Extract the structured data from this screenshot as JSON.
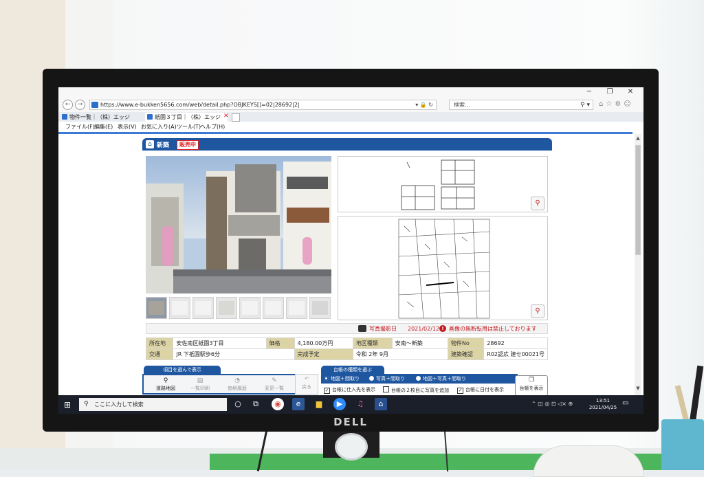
{
  "browser": {
    "url": "https://www.e-bukken5656.com/web/detail.php?OBJKEYS[]=02|28692|2|",
    "search_placeholder": "検索...",
    "tabs": [
      {
        "label": "物件一覧｜（株）エッジ"
      },
      {
        "label": "紙園３丁目｜（株）エッジ"
      }
    ],
    "menu": [
      "ファイル(F)",
      "編集(E)",
      "表示(V)",
      "お気に入り(A)",
      "ツール(T)",
      "ヘルプ(H)"
    ]
  },
  "listing": {
    "category": "新築",
    "status_badge": "販売中",
    "photo_date_label": "写真撮影日",
    "photo_date": "2021/02/12",
    "notice": "画像の無断転用は禁止しております",
    "info": {
      "row1": [
        {
          "key": "所在地",
          "value": "安佐南区紙園3丁目"
        },
        {
          "key": "価格",
          "value": "4,180.00万円"
        },
        {
          "key": "地区種類",
          "value": "安南～新築"
        },
        {
          "key": "物件No",
          "value": "28692"
        }
      ],
      "row2": [
        {
          "key": "交通",
          "value": "JR 下祇園駅歩6分"
        },
        {
          "key": "完成予定",
          "value": "令和 2年 9月"
        },
        {
          "key": "建築確認",
          "value": "R02認広 建セ00021号"
        }
      ]
    }
  },
  "tools": {
    "section1_label": "項目を選んで表示",
    "buttons": [
      "道路地図",
      "一覧印刷",
      "価格履歴",
      "変更一覧"
    ],
    "print_button": "戻る",
    "section2_label": "台帳の種類を選ぶ",
    "radios": [
      "地図＋間取り",
      "写真＋間取り",
      "地図＋写真＋間取り"
    ],
    "checks": [
      {
        "label": "台帳に仕入先を表示",
        "checked": true
      },
      {
        "label": "台帳の２枚目に写真を追加",
        "checked": false
      },
      {
        "label": "台帳に日付を表示",
        "checked": true
      }
    ],
    "daicho_button": "台帳を表示"
  },
  "taskbar": {
    "search_placeholder": "ここに入力して検索",
    "time": "13:51",
    "date": "2021/04/25"
  },
  "monitor": {
    "brand": "DELL"
  }
}
